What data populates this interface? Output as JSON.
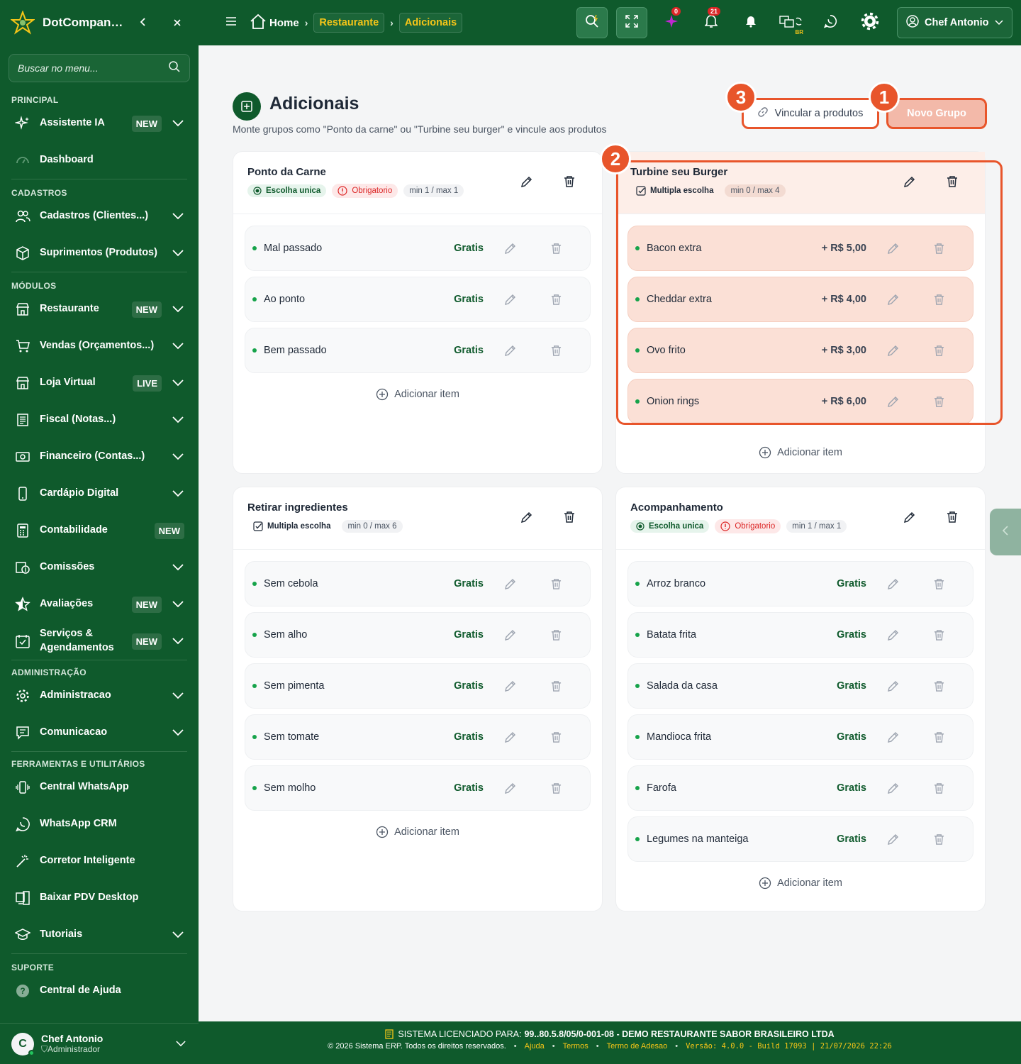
{
  "app": {
    "brand": "DotCompanion",
    "search_placeholder": "Buscar no menu..."
  },
  "colors": {
    "sidebar_bg": "#0f5a2c",
    "accent_gold": "#f5c518",
    "highlight": "#e8552b",
    "success": "#16a34a"
  },
  "sidebar": {
    "sections": {
      "principal": "PRINCIPAL",
      "cadastros": "CADASTROS",
      "modulos": "MÓDULOS",
      "admin": "ADMINISTRAÇÃO",
      "ferramentas": "FERRAMENTAS E UTILITÁRIOS",
      "suporte": "SUPORTE"
    },
    "items": {
      "assistente": {
        "label": "Assistente IA",
        "badge": "NEW"
      },
      "dashboard": {
        "label": "Dashboard"
      },
      "cadastros": {
        "label": "Cadastros (Clientes...)"
      },
      "suprimentos": {
        "label": "Suprimentos (Produtos)"
      },
      "restaurante": {
        "label": "Restaurante",
        "badge": "NEW"
      },
      "vendas": {
        "label": "Vendas (Orçamentos...)"
      },
      "loja": {
        "label": "Loja Virtual",
        "badge": "LIVE"
      },
      "fiscal": {
        "label": "Fiscal (Notas...)"
      },
      "financeiro": {
        "label": "Financeiro (Contas...)"
      },
      "cardapio": {
        "label": "Cardápio Digital"
      },
      "contabilidade": {
        "label": "Contabilidade",
        "badge": "NEW"
      },
      "comissoes": {
        "label": "Comissões"
      },
      "avaliacoes": {
        "label": "Avaliações",
        "badge": "NEW"
      },
      "servicos": {
        "label_line1": "Serviços &",
        "label_line2": "Agendamentos",
        "badge": "NEW"
      },
      "administracao": {
        "label": "Administracao"
      },
      "comunicacao": {
        "label": "Comunicacao"
      },
      "central_whatsapp": {
        "label": "Central WhatsApp"
      },
      "whatsapp_crm": {
        "label": "WhatsApp CRM"
      },
      "corretor": {
        "label": "Corretor Inteligente"
      },
      "baixar_pdv": {
        "label": "Baixar PDV Desktop"
      },
      "tutoriais": {
        "label": "Tutoriais"
      },
      "central_ajuda": {
        "label": "Central de Ajuda"
      }
    },
    "user": {
      "initial": "C",
      "name": "Chef Antonio",
      "role": "Administrador"
    }
  },
  "topbar": {
    "breadcrumb": {
      "home": "Home",
      "level1": "Restaurante",
      "level2": "Adicionais"
    },
    "badges": {
      "ai": "0",
      "notifications": "21"
    },
    "region": "BR",
    "user_name": "Chef Antonio"
  },
  "page": {
    "title": "Adicionais",
    "subtitle": "Monte grupos como \"Ponto da carne\" ou \"Turbine seu burger\" e vincule aos produtos",
    "vincular_label": "Vincular a produtos",
    "novo_grupo_label": "Novo Grupo",
    "steps": {
      "s1": "1",
      "s2": "2",
      "s3": "3"
    },
    "add_item_label": "Adicionar item"
  },
  "groups": {
    "g1": {
      "title": "Ponto da Carne",
      "chip_type": "Escolha unica",
      "chip_req": "Obrigatorio",
      "chip_range": "min 1 / max 1",
      "items": [
        {
          "name": "Mal passado",
          "price": "Gratis"
        },
        {
          "name": "Ao ponto",
          "price": "Gratis"
        },
        {
          "name": "Bem passado",
          "price": "Gratis"
        }
      ]
    },
    "g2": {
      "title": "Turbine seu Burger",
      "chip_type": "Multipla escolha",
      "chip_range": "min 0 / max 4",
      "items": [
        {
          "name": "Bacon extra",
          "price": "+ R$ 5,00"
        },
        {
          "name": "Cheddar extra",
          "price": "+ R$ 4,00"
        },
        {
          "name": "Ovo frito",
          "price": "+ R$ 3,00"
        },
        {
          "name": "Onion rings",
          "price": "+ R$ 6,00"
        }
      ]
    },
    "g3": {
      "title": "Retirar ingredientes",
      "chip_type": "Multipla escolha",
      "chip_range": "min 0 / max 6",
      "items": [
        {
          "name": "Sem cebola",
          "price": "Gratis"
        },
        {
          "name": "Sem alho",
          "price": "Gratis"
        },
        {
          "name": "Sem pimenta",
          "price": "Gratis"
        },
        {
          "name": "Sem tomate",
          "price": "Gratis"
        },
        {
          "name": "Sem molho",
          "price": "Gratis"
        }
      ]
    },
    "g4": {
      "title": "Acompanhamento",
      "chip_type": "Escolha unica",
      "chip_req": "Obrigatorio",
      "chip_range": "min 1 / max 1",
      "items": [
        {
          "name": "Arroz branco",
          "price": "Gratis"
        },
        {
          "name": "Batata frita",
          "price": "Gratis"
        },
        {
          "name": "Salada da casa",
          "price": "Gratis"
        },
        {
          "name": "Mandioca frita",
          "price": "Gratis"
        },
        {
          "name": "Farofa",
          "price": "Gratis"
        },
        {
          "name": "Legumes na manteiga",
          "price": "Gratis"
        }
      ]
    }
  },
  "footer": {
    "license_prefix": "SISTEMA LICENCIADO PARA:",
    "license_value": "99..80.5.8/05/0-001-08 - DEMO RESTAURANTE SABOR BRASILEIRO LTDA",
    "copyright": "© 2026 Sistema ERP. Todos os direitos reservados.",
    "link_ajuda": "Ajuda",
    "link_termos": "Termos",
    "link_adesao": "Termo de Adesao",
    "version": "Versão: 4.0.0 - Build 17093 | 21/07/2026 22:26"
  }
}
